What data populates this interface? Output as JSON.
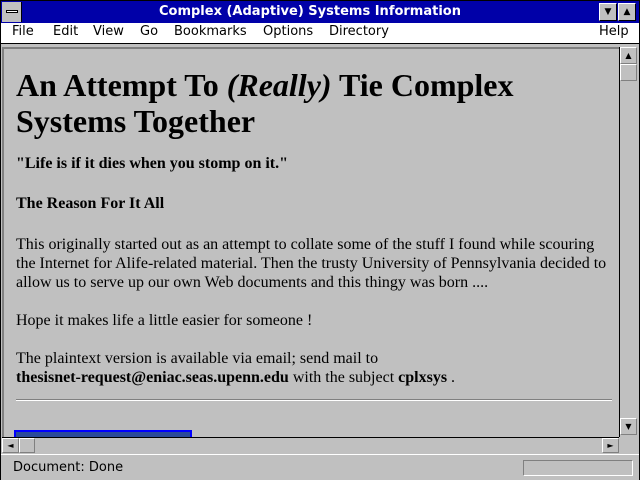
{
  "window": {
    "title": "Complex (Adaptive) Systems Information"
  },
  "menu": {
    "file": "File",
    "edit": "Edit",
    "view": "View",
    "go": "Go",
    "bookmarks": "Bookmarks",
    "options": "Options",
    "directory": "Directory",
    "help": "Help"
  },
  "page": {
    "heading_part1": "An Attempt To ",
    "heading_italic": "(Really)",
    "heading_part2": " Tie Complex Systems Together",
    "quote": "\"Life is if it dies when you stomp on it.\"",
    "subheading": "The Reason For It All",
    "paragraph1": "This originally started out as an attempt to collate some of the stuff I found while scouring the Internet for Alife-related material. Then the trusty University of Pennsylvania decided to allow us to serve up our own Web documents and this thingy was born ....",
    "paragraph2": "Hope it makes life a little easier for someone !",
    "paragraph3_prefix": "The plaintext version is available via email; send mail to",
    "email": "thesisnet-request@eniac.seas.upenn.edu",
    "paragraph3_middle": " with the subject ",
    "subject": "cplxsys",
    "paragraph3_suffix": " ."
  },
  "status": {
    "text": "Document: Done"
  },
  "icons": {
    "system_menu": "system-menu-icon",
    "minimize": "minimize-icon",
    "maximize": "maximize-icon",
    "scroll_up": "scroll-up-icon",
    "scroll_down": "scroll-down-icon",
    "scroll_left": "scroll-left-icon",
    "scroll_right": "scroll-right-icon"
  },
  "colors": {
    "titlebar": "#0000a8",
    "background": "#c0c0c0"
  }
}
